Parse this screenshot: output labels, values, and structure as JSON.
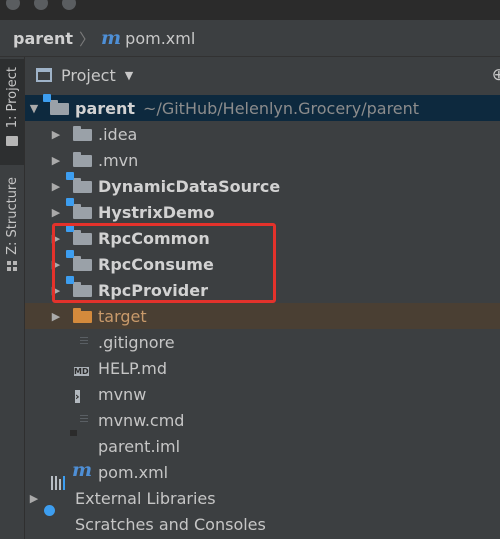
{
  "navbar": {
    "project": "parent",
    "file_icon": "maven-m-icon",
    "file_icon_glyph": "m",
    "file": "pom.xml"
  },
  "left_tabs": {
    "project_tab": "1: Project",
    "structure_tab": "Z: Structure"
  },
  "panel": {
    "title": "Project",
    "dropdown_icon": "chevron-down-icon"
  },
  "tree": {
    "root": {
      "label": "parent",
      "path": "~/GitHub/Helenlyn.Grocery/parent"
    },
    "items": [
      {
        "label": ".idea",
        "icon": "folder-icon"
      },
      {
        "label": ".mvn",
        "icon": "folder-icon"
      },
      {
        "label": "DynamicDataSource",
        "icon": "module-folder-icon"
      },
      {
        "label": "HystrixDemo",
        "icon": "module-folder-icon"
      },
      {
        "label": "RpcCommon",
        "icon": "module-folder-icon"
      },
      {
        "label": "RpcConsume",
        "icon": "module-folder-icon"
      },
      {
        "label": "RpcProvider",
        "icon": "module-folder-icon"
      },
      {
        "label": "target",
        "icon": "excluded-folder-icon"
      },
      {
        "label": ".gitignore",
        "icon": "text-file-icon"
      },
      {
        "label": "HELP.md",
        "icon": "markdown-file-icon",
        "badge": "MD"
      },
      {
        "label": "mvnw",
        "icon": "shell-file-icon"
      },
      {
        "label": "mvnw.cmd",
        "icon": "text-file-icon"
      },
      {
        "label": "parent.iml",
        "icon": "iml-file-icon"
      },
      {
        "label": "pom.xml",
        "icon": "maven-m-icon",
        "glyph": "m"
      }
    ],
    "external_libraries": "External Libraries",
    "scratches": "Scratches and Consoles"
  },
  "colors": {
    "selection": "#0d293e",
    "highlight_box": "#e4322b",
    "excluded_folder": "#d48a3c",
    "module_badge": "#3d9ef0"
  }
}
